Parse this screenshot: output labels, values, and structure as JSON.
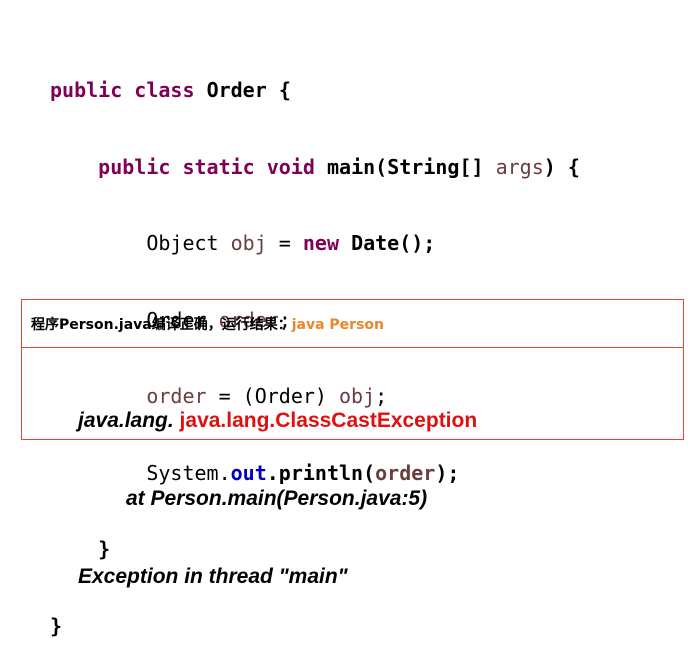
{
  "code": {
    "line1": {
      "kw1": "public",
      "kw2": "class",
      "name": "Order",
      "brace": "{"
    },
    "line2": {
      "kw1": "public",
      "kw2": "static",
      "kw3": "void",
      "method": "main(String[]",
      "arg": "args",
      "close": ")",
      "brace": "{"
    },
    "line3": {
      "type": "Object",
      "var": "obj",
      "eq": "=",
      "kw": "new",
      "ctor": "Date();"
    },
    "line4": {
      "type": "Order",
      "var": "order",
      "semi": ";"
    },
    "line5": {
      "var": "order",
      "rest": "= (Order)",
      "var2": "obj",
      "semi": ";"
    },
    "line6": {
      "cls": "System.",
      "field": "out",
      "call": ".println(",
      "var": "order",
      "end": ");"
    },
    "line7": {
      "brace": "}"
    },
    "line8": {
      "brace": "}"
    }
  },
  "result": {
    "label": "程序Person.java编译正确，运行结果：",
    "command": "java Person",
    "output_prefix": "java.lang.",
    "exception": " java.lang.ClassCastException",
    "stack_line": "at Person.main(Person.java:5)",
    "thread_line": "Exception in thread \"main\""
  }
}
